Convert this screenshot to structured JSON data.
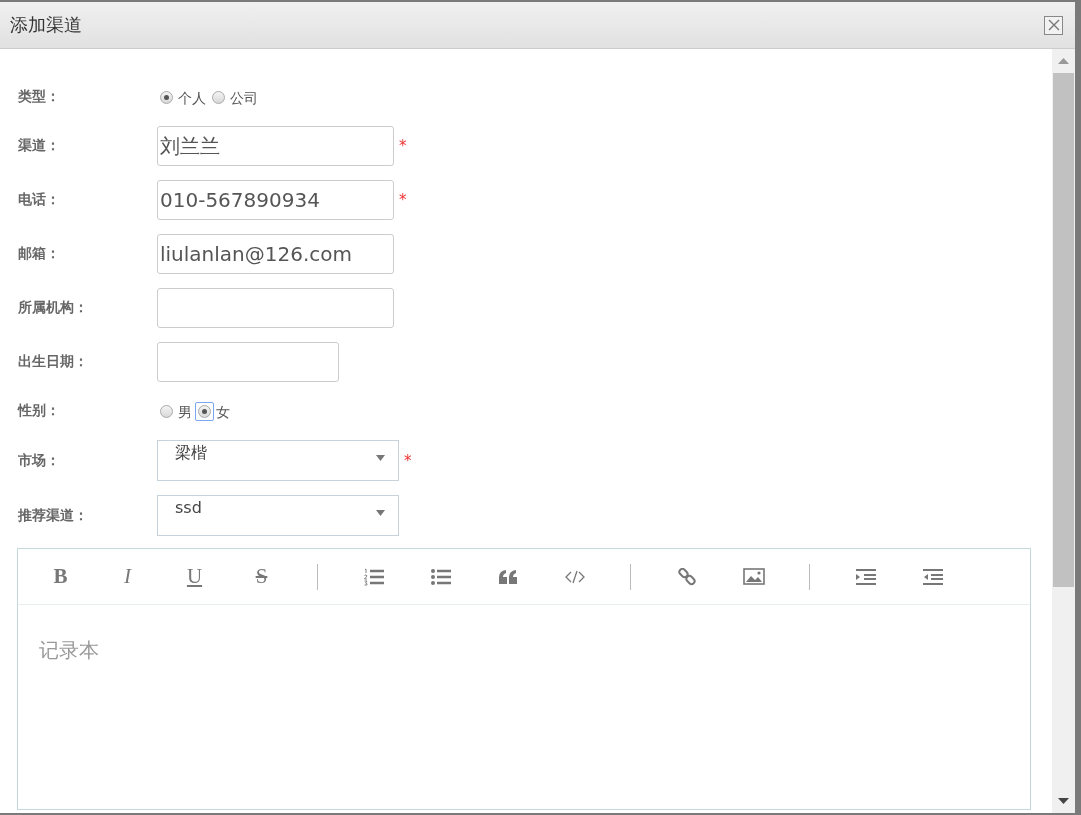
{
  "window": {
    "title": "添加渠道"
  },
  "fields": [
    {
      "kind": "radio",
      "label": "类型：",
      "options": [
        {
          "label": "个人",
          "selected": true,
          "focused": false
        },
        {
          "label": "公司",
          "selected": false,
          "focused": false
        }
      ]
    },
    {
      "kind": "text",
      "label": "渠道：",
      "value": "刘兰兰",
      "required": true
    },
    {
      "kind": "text",
      "label": "电话：",
      "value": "010-567890934",
      "required": true
    },
    {
      "kind": "text",
      "label": "邮箱：",
      "value": "liulanlan@126.com",
      "required": false
    },
    {
      "kind": "text",
      "label": "所属机构：",
      "required": false
    },
    {
      "kind": "date",
      "label": "出生日期：",
      "required": false
    },
    {
      "kind": "radio",
      "label": "性别：",
      "options": [
        {
          "label": "男",
          "selected": false,
          "focused": false
        },
        {
          "label": "女",
          "selected": true,
          "focused": true
        }
      ]
    },
    {
      "kind": "select",
      "label": "市场：",
      "value": "梁楷",
      "required": true
    },
    {
      "kind": "select",
      "label": "推荐渠道：",
      "value": "ssd",
      "required": false
    }
  ],
  "required_mark": "*",
  "editor": {
    "toolbar": [
      [
        {
          "kind": "bold",
          "glyph": "B"
        },
        {
          "kind": "italic",
          "glyph": "I"
        },
        {
          "kind": "underline",
          "glyph": "U"
        },
        {
          "kind": "strike",
          "glyph": "S"
        }
      ],
      [
        {
          "kind": "ordered-list"
        },
        {
          "kind": "bullet-list"
        },
        {
          "kind": "quote"
        },
        {
          "kind": "code"
        }
      ],
      [
        {
          "kind": "link"
        },
        {
          "kind": "image"
        }
      ],
      [
        {
          "kind": "indent"
        },
        {
          "kind": "outdent"
        }
      ]
    ],
    "placeholder": "记录本"
  }
}
